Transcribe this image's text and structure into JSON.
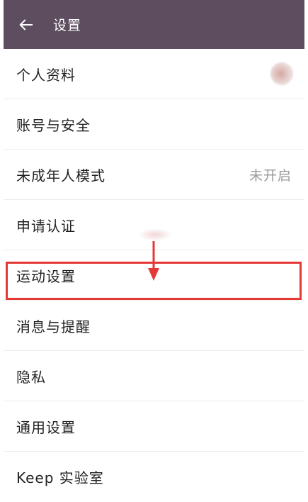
{
  "header": {
    "back_icon": "arrow-left-icon",
    "title": "设置"
  },
  "settings": {
    "items": [
      {
        "label": "个人资料",
        "value": "",
        "accessory": "avatar"
      },
      {
        "label": "账号与安全",
        "value": ""
      },
      {
        "label": "未成年人模式",
        "value": "未开启"
      },
      {
        "label": "申请认证",
        "value": ""
      },
      {
        "label": "运动设置",
        "value": "",
        "highlighted": true
      },
      {
        "label": "消息与提醒",
        "value": ""
      },
      {
        "label": "隐私",
        "value": ""
      },
      {
        "label": "通用设置",
        "value": ""
      },
      {
        "label": "Keep 实验室",
        "value": ""
      }
    ]
  },
  "annotation": {
    "highlight_color": "#e53935",
    "arrow_icon": "arrow-down-icon"
  },
  "colors": {
    "header_bg": "#5d4d5f",
    "text": "#222222",
    "secondary_text": "#999999"
  }
}
